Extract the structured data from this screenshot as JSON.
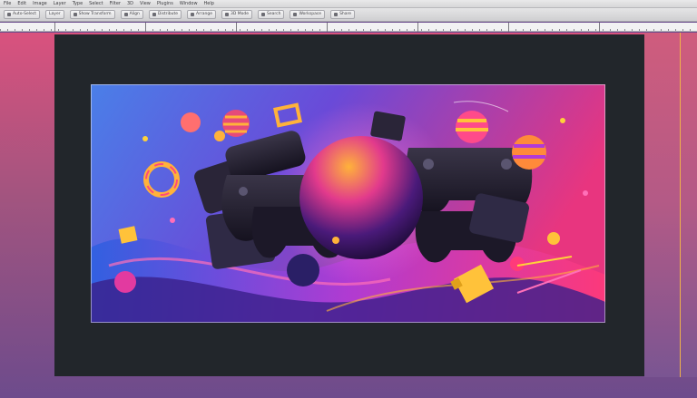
{
  "menubar": {
    "items": [
      "File",
      "Edit",
      "Image",
      "Layer",
      "Type",
      "Select",
      "Filter",
      "3D",
      "View",
      "Plugins",
      "Window",
      "Help"
    ]
  },
  "toolbar": {
    "buttons": [
      "Auto-Select",
      "Layer",
      "Show Transform",
      "Align",
      "Distribute",
      "Arrange",
      "3D Mode",
      "Search",
      "Workspace",
      "Share"
    ]
  },
  "canvas": {
    "artwork": "gaming-controllers-illustration",
    "colors": {
      "background_left": "#4a7fe8",
      "background_right": "#e8357f",
      "pasteboard": "#22262b",
      "guide": "#f0b24a",
      "orb": "#2a0f4a"
    }
  }
}
